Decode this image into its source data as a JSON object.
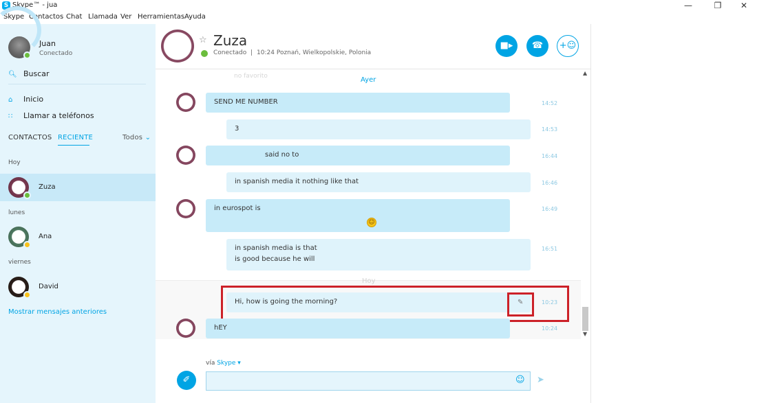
{
  "window": {
    "title": "Skype™ - jua",
    "logo_letter": "S",
    "minimize": "—",
    "restore": "❐",
    "close": "✕"
  },
  "menu": [
    "Skype",
    "Contactos",
    "Chat",
    "Llamada",
    "Ver",
    "Herramientas",
    "Ayuda"
  ],
  "profile": {
    "name": "Juan",
    "status": "Conectado"
  },
  "sidebar": {
    "search_label": "Buscar",
    "home_label": "Inicio",
    "call_phones_label": "Llamar a teléfonos",
    "tab_contacts": "CONTACTOS",
    "tab_recent": "RECIENTE",
    "filter_label": "Todos",
    "groups": [
      {
        "label": "Hoy"
      },
      {
        "label": "lunes"
      },
      {
        "label": "viernes"
      }
    ],
    "contacts": [
      {
        "name": "Zuza",
        "status": "online"
      },
      {
        "name": "Ana",
        "status": "away"
      },
      {
        "name": "David",
        "status": "away"
      }
    ],
    "show_older": "Mostrar mensajes anteriores"
  },
  "header": {
    "name": "Zuza",
    "status": "Conectado",
    "separator": "|",
    "location": "10:24 Poznań, Wielkopolskie, Polonia"
  },
  "conversation": {
    "faded_text": "no favorito",
    "day_yesterday": "Ayer",
    "day_today": "Hoy",
    "messages": [
      {
        "text": "SEND ME NUMBER",
        "time": "14:52",
        "from": "Zuza"
      },
      {
        "text": "3",
        "time": "14:53",
        "from": "me"
      },
      {
        "text": "said no to",
        "time": "16:44",
        "from": "Zuza"
      },
      {
        "text": "in spanish media it nothing like that",
        "time": "16:46",
        "from": "me"
      },
      {
        "text": "in eurospot is",
        "time": "16:49",
        "from": "Zuza"
      },
      {
        "line1": "in spanish media is that",
        "line2": "is good because he will",
        "time": "16:51",
        "from": "me"
      },
      {
        "text": "Hi, how is going the morning?",
        "time": "10:23",
        "from": "me",
        "edited_icon": "✎"
      },
      {
        "text": "hEY",
        "time": "10:24",
        "from": "Zuza"
      }
    ]
  },
  "compose": {
    "via_prefix": "vía",
    "via_service": "Skype",
    "placeholder": ""
  },
  "colors": {
    "accent": "#00a4e4",
    "sidebar_bg": "#e5f5fc",
    "bubble": "#c7ebf9",
    "highlight": "#cc2128"
  }
}
